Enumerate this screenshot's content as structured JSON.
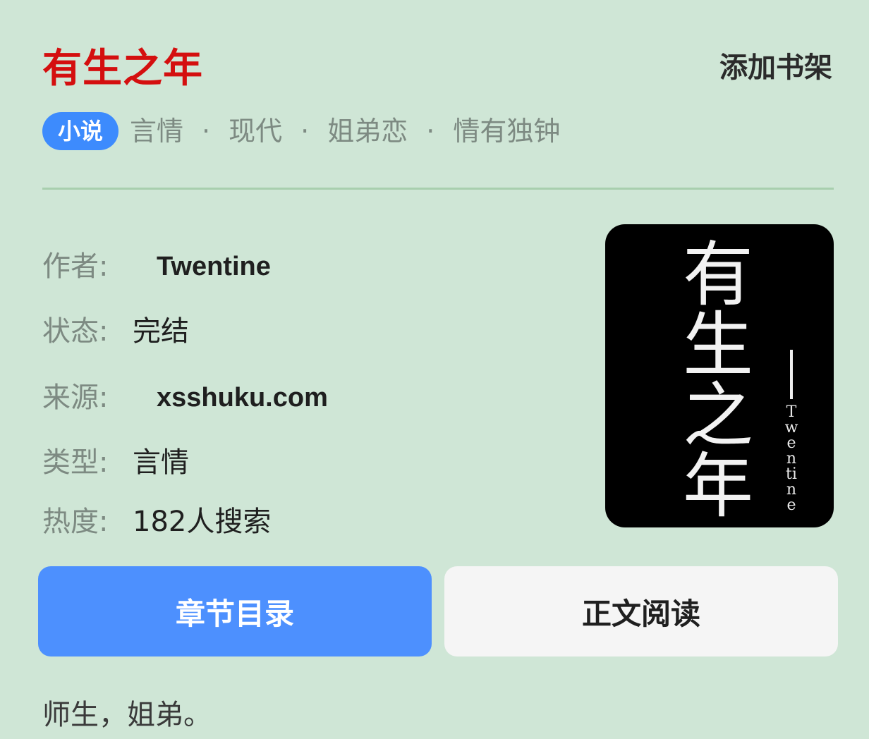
{
  "book": {
    "title": "有生之年",
    "add_shelf_label": "添加书架",
    "category_badge": "小说",
    "tags": [
      "言情",
      "现代",
      "姐弟恋",
      "情有独钟"
    ],
    "tag_separator": "·",
    "info": {
      "author_label": "作者:",
      "author_value": "Twentine",
      "status_label": "状态:",
      "status_value": "完结",
      "source_label": "来源:",
      "source_value": "xsshuku.com",
      "type_label": "类型:",
      "type_value": "言情",
      "popularity_label": "热度:",
      "popularity_value": "182人搜索"
    },
    "cover": {
      "chars": [
        "有",
        "生",
        "之",
        "年"
      ],
      "author": "Twentine",
      "background_color": "#000000"
    },
    "buttons": {
      "toc_label": "章节目录",
      "read_label": "正文阅读"
    },
    "summary": "师生，姐弟。"
  },
  "colors": {
    "page_background": "#cfe6d6",
    "title_red": "#d40f0f",
    "badge_blue": "#3d8bfd",
    "primary_button": "#4d90fe",
    "secondary_button": "#f5f5f5"
  }
}
